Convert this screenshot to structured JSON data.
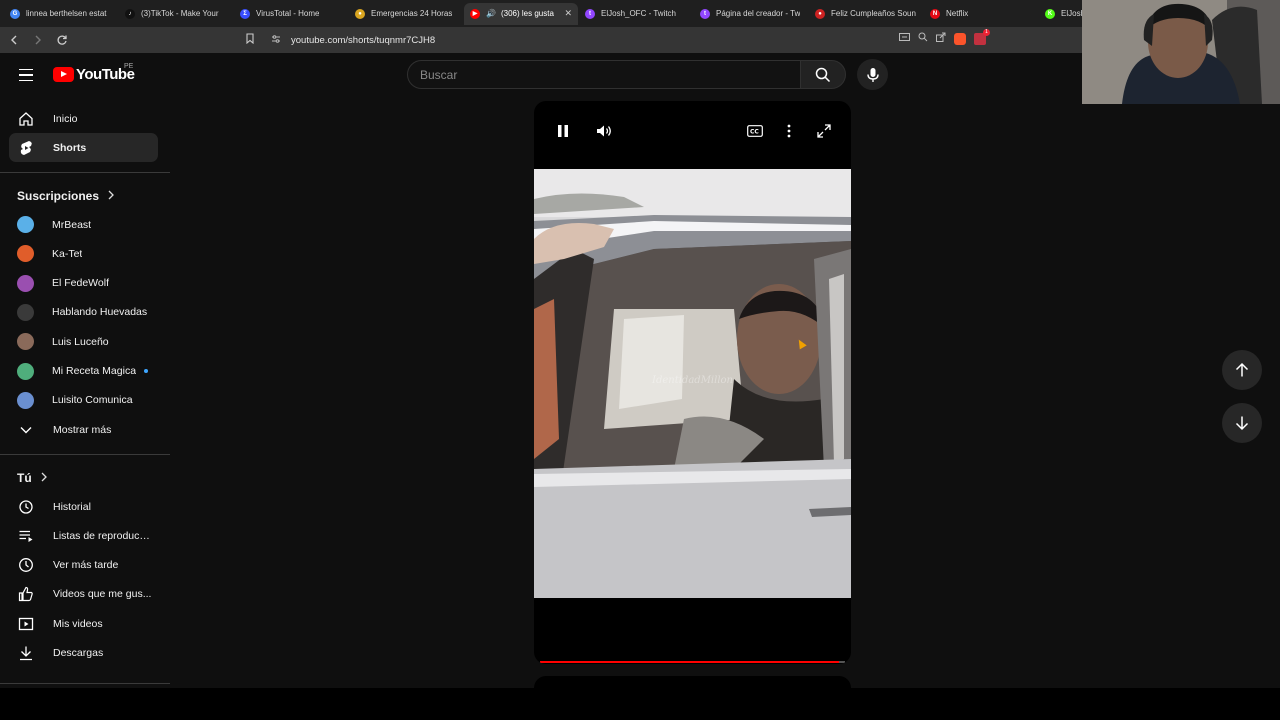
{
  "browser": {
    "tabs": [
      {
        "label": "linnea berthelsen estat",
        "color": "#4285f4",
        "glyph": "G",
        "active": false
      },
      {
        "label": "(3)TikTok - Make Your",
        "color": "#111111",
        "glyph": "♪",
        "active": false
      },
      {
        "label": "VirusTotal - Home",
        "color": "#394eff",
        "glyph": "Σ",
        "active": false
      },
      {
        "label": "Emergencias 24 Horas",
        "color": "#d9a520",
        "glyph": "●",
        "active": false
      },
      {
        "label": "(306) les gusta",
        "color": "#ff0000",
        "glyph": "▶",
        "active": true,
        "audio": true
      },
      {
        "label": "ElJosh_OFC - Twitch",
        "color": "#9146ff",
        "glyph": "t",
        "active": false
      },
      {
        "label": "Página del creador - Tw",
        "color": "#9146ff",
        "glyph": "t",
        "active": false
      },
      {
        "label": "Feliz Cumpleaños Soun",
        "color": "#cc2222",
        "glyph": "●",
        "active": false
      },
      {
        "label": "Netflix",
        "color": "#e50914",
        "glyph": "N",
        "active": false
      },
      {
        "label": "ElJoshOF",
        "color": "#53fc18",
        "glyph": "K",
        "active": false
      }
    ],
    "url": "youtube.com/shorts/tuqnmr7CJH8",
    "close_glyph": "✕",
    "shields_count": "1"
  },
  "header": {
    "logo_text": "YouTube",
    "country_code": "PE",
    "search_placeholder": "Buscar"
  },
  "sidebar": {
    "main": [
      {
        "label": "Inicio",
        "icon": "home-icon",
        "active": false
      },
      {
        "label": "Shorts",
        "icon": "shorts-icon",
        "active": true
      }
    ],
    "subscriptions_title": "Suscripciones",
    "subscriptions": [
      {
        "label": "MrBeast",
        "color": "#5ab0e8",
        "live": false
      },
      {
        "label": "Ka-Tet",
        "color": "#e05d2a",
        "live": false
      },
      {
        "label": "El FedeWolf",
        "color": "#9a4fb0",
        "live": false
      },
      {
        "label": "Hablando Huevadas",
        "color": "#3a3a3a",
        "live": false
      },
      {
        "label": "Luis Luceño",
        "color": "#8a6a5a",
        "live": false
      },
      {
        "label": "Mi Receta Magica",
        "color": "#4fae7c",
        "live": true
      },
      {
        "label": "Luisito Comunica",
        "color": "#6a8fd0",
        "live": false
      }
    ],
    "show_more": "Mostrar más",
    "you_title": "Tú",
    "you_items": [
      {
        "label": "Historial",
        "icon": "history-icon"
      },
      {
        "label": "Listas de reproducc...",
        "icon": "playlists-icon"
      },
      {
        "label": "Ver más tarde",
        "icon": "watch-later-icon"
      },
      {
        "label": "Videos que me gus...",
        "icon": "liked-icon"
      },
      {
        "label": "Mis videos",
        "icon": "my-videos-icon"
      },
      {
        "label": "Descargas",
        "icon": "downloads-icon"
      }
    ]
  },
  "player": {
    "watermark": "IdentidadMillon",
    "progress": 0.98
  },
  "colors": {
    "accent": "#ff0000",
    "background": "#0f0f0f"
  }
}
